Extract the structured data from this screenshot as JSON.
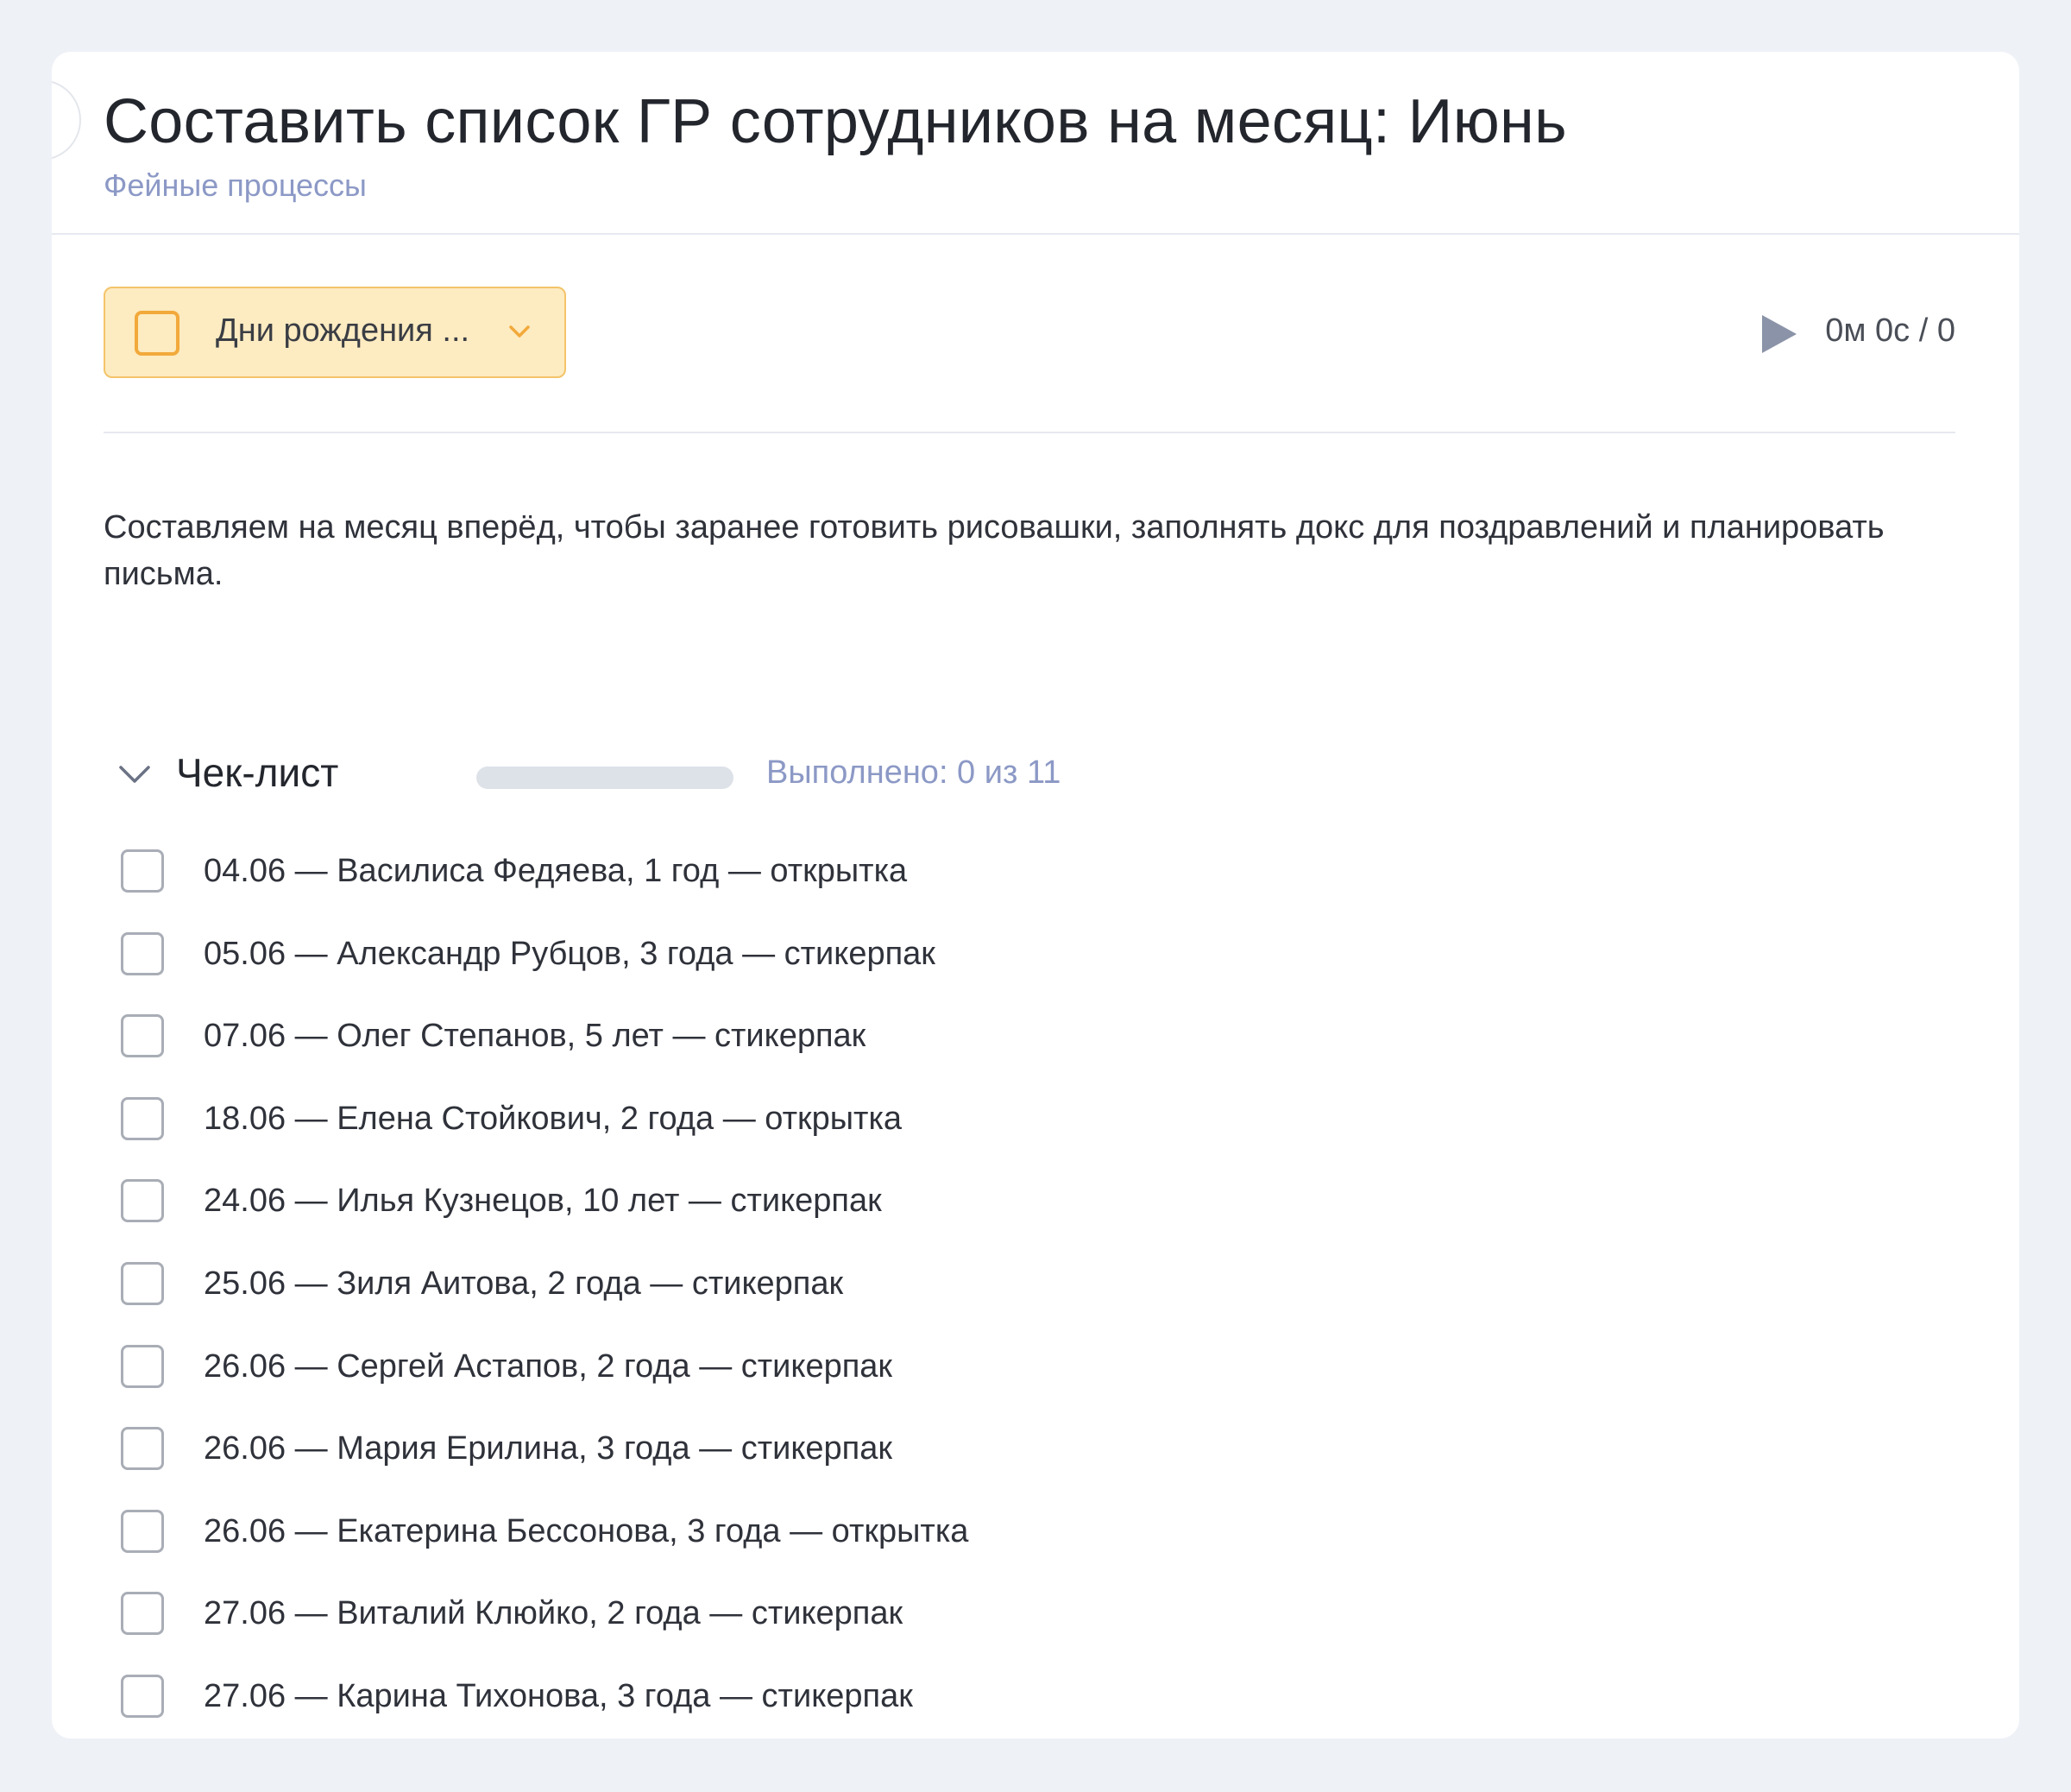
{
  "task": {
    "title": "Составить список ГР сотрудников на месяц: Июнь",
    "project": "Фейные процессы"
  },
  "toolbar": {
    "status_label": "Дни рождения ...",
    "timer": "0м 0с / 0"
  },
  "description": "Составляем на месяц вперёд, чтобы заранее готовить рисовашки, заполнять докс для поздравлений и планировать письма.",
  "checklist": {
    "title": "Чек-лист",
    "progress_text": "Выполнено: 0 из 11",
    "done": 0,
    "total": 11,
    "items": [
      {
        "label": "04.06 — Василиса Федяева, 1 год — открытка",
        "checked": false
      },
      {
        "label": "05.06 — Александр Рубцов, 3 года — стикерпак",
        "checked": false
      },
      {
        "label": "07.06 — Олег Степанов, 5 лет — стикерпак",
        "checked": false
      },
      {
        "label": "18.06 — Елена Стойкович, 2 года — открытка",
        "checked": false
      },
      {
        "label": "24.06 — Илья Кузнецов, 10 лет — стикерпак",
        "checked": false
      },
      {
        "label": "25.06 — Зиля Аитова, 2 года — стикерпак",
        "checked": false
      },
      {
        "label": "26.06 — Сергей Астапов, 2 года — стикерпак",
        "checked": false
      },
      {
        "label": "26.06 — Мария Ерилина, 3 года — стикерпак",
        "checked": false
      },
      {
        "label": "26.06 — Екатерина Бессонова, 3 года — открытка",
        "checked": false
      },
      {
        "label": "27.06 — Виталий Клюйко, 2 года — стикерпак",
        "checked": false
      },
      {
        "label": "27.06 — Карина Тихонова, 3 года — стикерпак",
        "checked": false
      }
    ]
  },
  "colors": {
    "accent": "#f2a93b",
    "status_bg": "#fdebc1",
    "muted": "#8c99c6",
    "play_icon": "#8b93a8"
  },
  "icons": {
    "status": "checkbox-icon",
    "dropdown": "chevron-down-icon",
    "play": "play-icon",
    "collapse": "chevron-down-icon"
  }
}
